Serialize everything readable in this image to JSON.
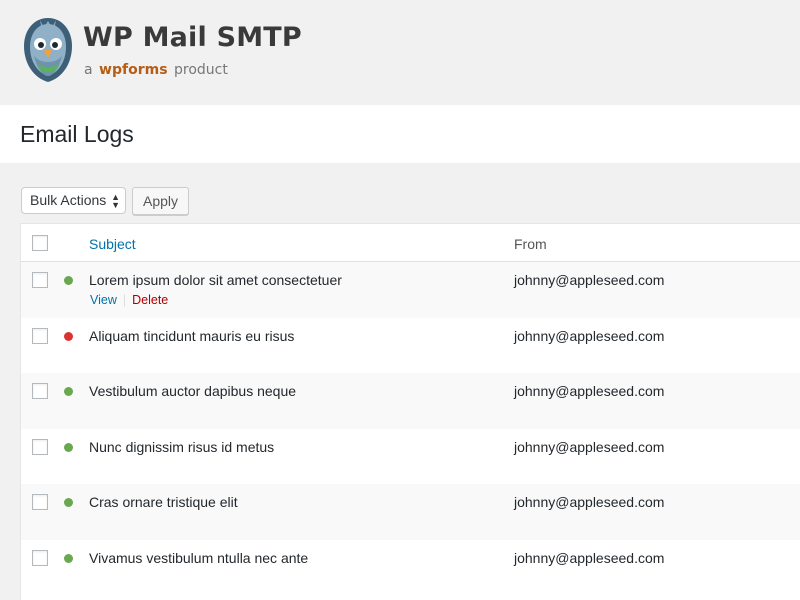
{
  "brand": {
    "title": "WP Mail SMTP",
    "sub_prefix": "a",
    "sub_brand": "wpforms",
    "sub_suffix": "product"
  },
  "page": {
    "title": "Email Logs"
  },
  "toolbar": {
    "bulk_label": "Bulk Actions",
    "apply_label": "Apply"
  },
  "table": {
    "headers": {
      "subject": "Subject",
      "from": "From"
    },
    "rows": [
      {
        "subject": "Lorem ipsum dolor sit amet consectetuer",
        "from": "johnny@appleseed.com",
        "status": "success",
        "view": "View",
        "delete": "Delete"
      },
      {
        "subject": "Aliquam tincidunt mauris eu risus",
        "from": "johnny@appleseed.com",
        "status": "failed"
      },
      {
        "subject": "Vestibulum auctor dapibus neque",
        "from": "johnny@appleseed.com",
        "status": "success"
      },
      {
        "subject": "Nunc dignissim risus id metus",
        "from": "johnny@appleseed.com",
        "status": "success"
      },
      {
        "subject": "Cras ornare tristique elit",
        "from": "johnny@appleseed.com",
        "status": "success"
      },
      {
        "subject": "Vivamus vestibulum ntulla nec ante",
        "from": "johnny@appleseed.com",
        "status": "success"
      }
    ]
  },
  "colors": {
    "success": "#6aa84f",
    "failed": "#dc3232",
    "link": "#0073aa",
    "delete": "#aa0000"
  }
}
